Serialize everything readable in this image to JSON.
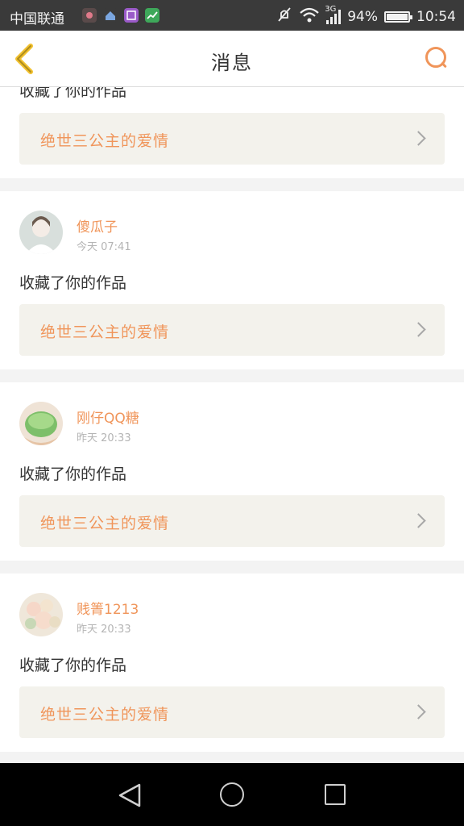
{
  "status_bar": {
    "carrier": "中国联通",
    "network": "3G",
    "battery": "94%",
    "battery_level": 0.94,
    "time": "10:54"
  },
  "header": {
    "title": "消息"
  },
  "colors": {
    "accent": "#f0955a",
    "work_bg": "#f3f2ec",
    "status_bar": "#3a3a3a"
  },
  "messages": [
    {
      "action": "收藏了你的作品",
      "work_title": "绝世三公主的爱情"
    },
    {
      "user": "傻瓜子",
      "time": "今天 07:41",
      "action": "收藏了你的作品",
      "work_title": "绝世三公主的爱情",
      "avatar_icon": "user-avatar-icon"
    },
    {
      "user": "刚仔QQ糖",
      "time": "昨天 20:33",
      "action": "收藏了你的作品",
      "work_title": "绝世三公主的爱情",
      "avatar_icon": "user-avatar-icon"
    },
    {
      "user": "贱箐1213",
      "time": "昨天 20:33",
      "action": "收藏了你的作品",
      "work_title": "绝世三公主的爱情",
      "avatar_icon": "user-avatar-icon"
    }
  ]
}
